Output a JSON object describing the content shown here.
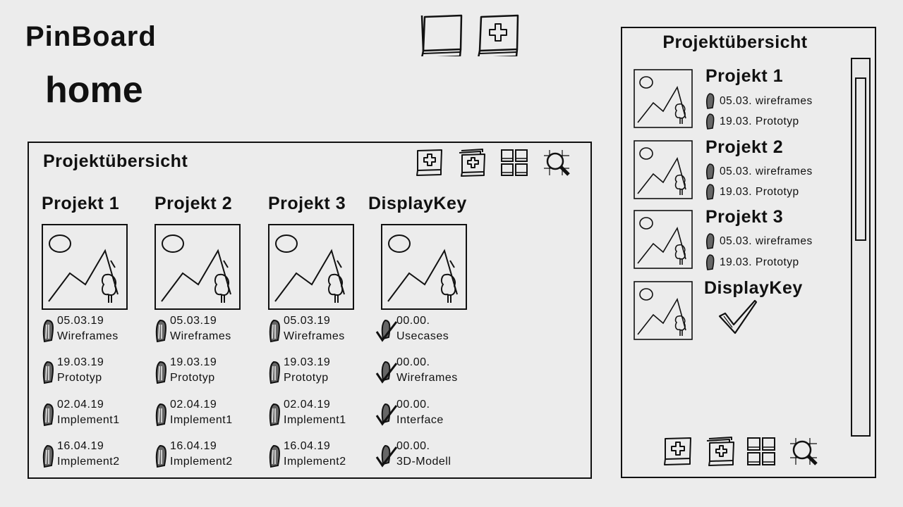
{
  "app": {
    "title": "PinBoard"
  },
  "page": {
    "heading": "home"
  },
  "toolbar": {
    "icons": [
      "blank-board-icon",
      "add-board-icon"
    ]
  },
  "main_panel": {
    "title": "Projektübersicht",
    "tools": [
      "add-icon",
      "add-multiple-icon",
      "grid-view-icon",
      "search-zoom-icon"
    ],
    "columns": [
      {
        "title": "Projekt 1",
        "entries": [
          {
            "date": "05.03.19",
            "label": "Wireframes",
            "icon": "pen-icon"
          },
          {
            "date": "19.03.19",
            "label": "Prototyp",
            "icon": "pen-icon"
          },
          {
            "date": "02.04.19",
            "label": "Implement1",
            "icon": "pen-icon"
          },
          {
            "date": "16.04.19",
            "label": "Implement2",
            "icon": "pen-icon"
          }
        ]
      },
      {
        "title": "Projekt 2",
        "entries": [
          {
            "date": "05.03.19",
            "label": "Wireframes",
            "icon": "pen-icon"
          },
          {
            "date": "19.03.19",
            "label": "Prototyp",
            "icon": "pen-icon"
          },
          {
            "date": "02.04.19",
            "label": "Implement1",
            "icon": "pen-icon"
          },
          {
            "date": "16.04.19",
            "label": "Implement2",
            "icon": "pen-icon"
          }
        ]
      },
      {
        "title": "Projekt 3",
        "entries": [
          {
            "date": "05.03.19",
            "label": "Wireframes",
            "icon": "pen-icon"
          },
          {
            "date": "19.03.19",
            "label": "Prototyp",
            "icon": "pen-icon"
          },
          {
            "date": "02.04.19",
            "label": "Implement1",
            "icon": "pen-icon"
          },
          {
            "date": "16.04.19",
            "label": "Implement2",
            "icon": "pen-icon"
          }
        ]
      },
      {
        "title": "DisplayKey",
        "entries": [
          {
            "date": "00.00.",
            "label": "Usecases",
            "icon": "pen-check-icon"
          },
          {
            "date": "00.00.",
            "label": "Wireframes",
            "icon": "pen-check-icon"
          },
          {
            "date": "00.00.",
            "label": "Interface",
            "icon": "pen-check-icon"
          },
          {
            "date": "00.00.",
            "label": "3D-Modell",
            "icon": "pen-check-icon"
          }
        ]
      }
    ]
  },
  "side_panel": {
    "title": "Projektübersicht",
    "items": [
      {
        "title": "Projekt 1",
        "lines": [
          "05.03. wireframes",
          "19.03. Prototyp"
        ]
      },
      {
        "title": "Projekt 2",
        "lines": [
          "05.03. wireframes",
          "19.03. Prototyp"
        ]
      },
      {
        "title": "Projekt 3",
        "lines": [
          "05.03. wireframes",
          "19.03. Prototyp"
        ]
      },
      {
        "title": "DisplayKey",
        "lines": []
      }
    ],
    "tools": [
      "add-icon",
      "add-multiple-icon",
      "grid-view-icon",
      "search-zoom-icon"
    ]
  }
}
